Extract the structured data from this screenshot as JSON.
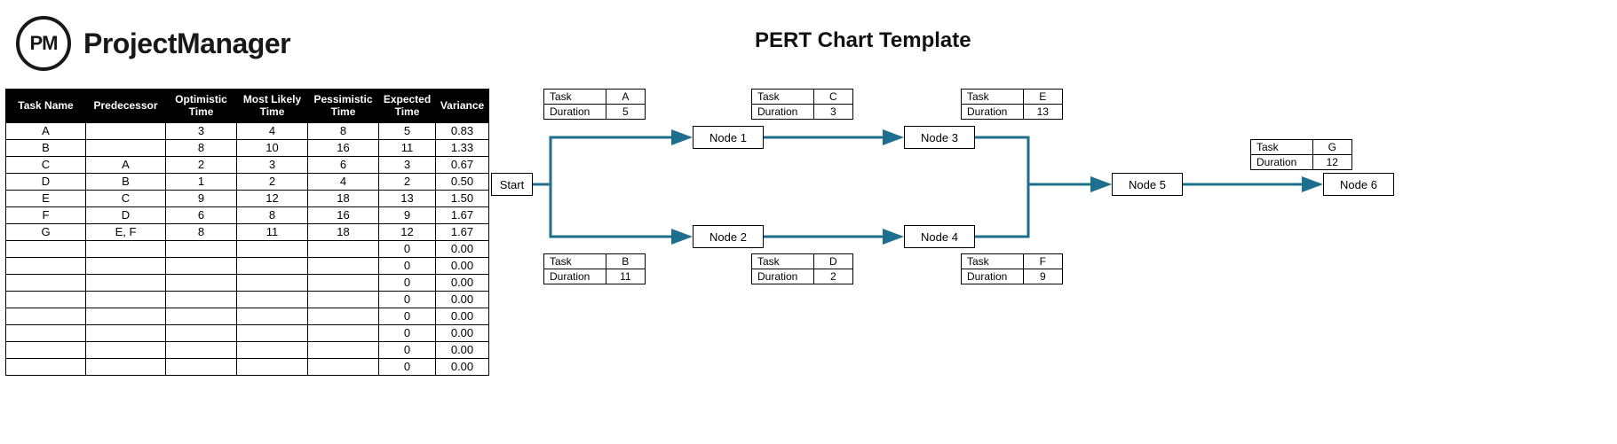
{
  "brand": {
    "abbr": "PM",
    "name": "ProjectManager"
  },
  "title": "PERT Chart Template",
  "table": {
    "headers": [
      "Task Name",
      "Predecessor",
      "Optimistic Time",
      "Most Likely Time",
      "Pessimistic Time",
      "Expected Time",
      "Variance"
    ],
    "rows": [
      {
        "name": "A",
        "pred": "",
        "opt": "3",
        "ml": "4",
        "pes": "8",
        "exp": "5",
        "var": "0.83"
      },
      {
        "name": "B",
        "pred": "",
        "opt": "8",
        "ml": "10",
        "pes": "16",
        "exp": "11",
        "var": "1.33"
      },
      {
        "name": "C",
        "pred": "A",
        "opt": "2",
        "ml": "3",
        "pes": "6",
        "exp": "3",
        "var": "0.67"
      },
      {
        "name": "D",
        "pred": "B",
        "opt": "1",
        "ml": "2",
        "pes": "4",
        "exp": "2",
        "var": "0.50"
      },
      {
        "name": "E",
        "pred": "C",
        "opt": "9",
        "ml": "12",
        "pes": "18",
        "exp": "13",
        "var": "1.50"
      },
      {
        "name": "F",
        "pred": "D",
        "opt": "6",
        "ml": "8",
        "pes": "16",
        "exp": "9",
        "var": "1.67"
      },
      {
        "name": "G",
        "pred": "E, F",
        "opt": "8",
        "ml": "11",
        "pes": "18",
        "exp": "12",
        "var": "1.67"
      },
      {
        "name": "",
        "pred": "",
        "opt": "",
        "ml": "",
        "pes": "",
        "exp": "0",
        "var": "0.00"
      },
      {
        "name": "",
        "pred": "",
        "opt": "",
        "ml": "",
        "pes": "",
        "exp": "0",
        "var": "0.00"
      },
      {
        "name": "",
        "pred": "",
        "opt": "",
        "ml": "",
        "pes": "",
        "exp": "0",
        "var": "0.00"
      },
      {
        "name": "",
        "pred": "",
        "opt": "",
        "ml": "",
        "pes": "",
        "exp": "0",
        "var": "0.00"
      },
      {
        "name": "",
        "pred": "",
        "opt": "",
        "ml": "",
        "pes": "",
        "exp": "0",
        "var": "0.00"
      },
      {
        "name": "",
        "pred": "",
        "opt": "",
        "ml": "",
        "pes": "",
        "exp": "0",
        "var": "0.00"
      },
      {
        "name": "",
        "pred": "",
        "opt": "",
        "ml": "",
        "pes": "",
        "exp": "0",
        "var": "0.00"
      },
      {
        "name": "",
        "pred": "",
        "opt": "",
        "ml": "",
        "pes": "",
        "exp": "0",
        "var": "0.00"
      }
    ]
  },
  "chart": {
    "field_task_label": "Task",
    "field_duration_label": "Duration",
    "start_label": "Start",
    "nodes": [
      {
        "id": "node1",
        "label": "Node 1"
      },
      {
        "id": "node2",
        "label": "Node 2"
      },
      {
        "id": "node3",
        "label": "Node 3"
      },
      {
        "id": "node4",
        "label": "Node 4"
      },
      {
        "id": "node5",
        "label": "Node 5"
      },
      {
        "id": "node6",
        "label": "Node 6"
      }
    ],
    "tasks": [
      {
        "id": "A",
        "task": "A",
        "dur": "5"
      },
      {
        "id": "B",
        "task": "B",
        "dur": "11"
      },
      {
        "id": "C",
        "task": "C",
        "dur": "3"
      },
      {
        "id": "D",
        "task": "D",
        "dur": "2"
      },
      {
        "id": "E",
        "task": "E",
        "dur": "13"
      },
      {
        "id": "F",
        "task": "F",
        "dur": "9"
      },
      {
        "id": "G",
        "task": "G",
        "dur": "12"
      }
    ]
  },
  "chart_data": {
    "type": "pert",
    "title": "PERT Chart Template",
    "tasks": [
      {
        "name": "A",
        "predecessors": [],
        "optimistic": 3,
        "most_likely": 4,
        "pessimistic": 8,
        "expected": 5,
        "variance": 0.83
      },
      {
        "name": "B",
        "predecessors": [],
        "optimistic": 8,
        "most_likely": 10,
        "pessimistic": 16,
        "expected": 11,
        "variance": 1.33
      },
      {
        "name": "C",
        "predecessors": [
          "A"
        ],
        "optimistic": 2,
        "most_likely": 3,
        "pessimistic": 6,
        "expected": 3,
        "variance": 0.67
      },
      {
        "name": "D",
        "predecessors": [
          "B"
        ],
        "optimistic": 1,
        "most_likely": 2,
        "pessimistic": 4,
        "expected": 2,
        "variance": 0.5
      },
      {
        "name": "E",
        "predecessors": [
          "C"
        ],
        "optimistic": 9,
        "most_likely": 12,
        "pessimistic": 18,
        "expected": 13,
        "variance": 1.5
      },
      {
        "name": "F",
        "predecessors": [
          "D"
        ],
        "optimistic": 6,
        "most_likely": 8,
        "pessimistic": 16,
        "expected": 9,
        "variance": 1.67
      },
      {
        "name": "G",
        "predecessors": [
          "E",
          "F"
        ],
        "optimistic": 8,
        "most_likely": 11,
        "pessimistic": 18,
        "expected": 12,
        "variance": 1.67
      }
    ],
    "nodes": [
      "Start",
      "Node 1",
      "Node 2",
      "Node 3",
      "Node 4",
      "Node 5",
      "Node 6"
    ],
    "edges": [
      {
        "from": "Start",
        "to": "Node 1",
        "task": "A",
        "duration": 5
      },
      {
        "from": "Start",
        "to": "Node 2",
        "task": "B",
        "duration": 11
      },
      {
        "from": "Node 1",
        "to": "Node 3",
        "task": "C",
        "duration": 3
      },
      {
        "from": "Node 2",
        "to": "Node 4",
        "task": "D",
        "duration": 2
      },
      {
        "from": "Node 3",
        "to": "Node 5",
        "task": "E",
        "duration": 13
      },
      {
        "from": "Node 4",
        "to": "Node 5",
        "task": "F",
        "duration": 9
      },
      {
        "from": "Node 5",
        "to": "Node 6",
        "task": "G",
        "duration": 12
      }
    ]
  }
}
